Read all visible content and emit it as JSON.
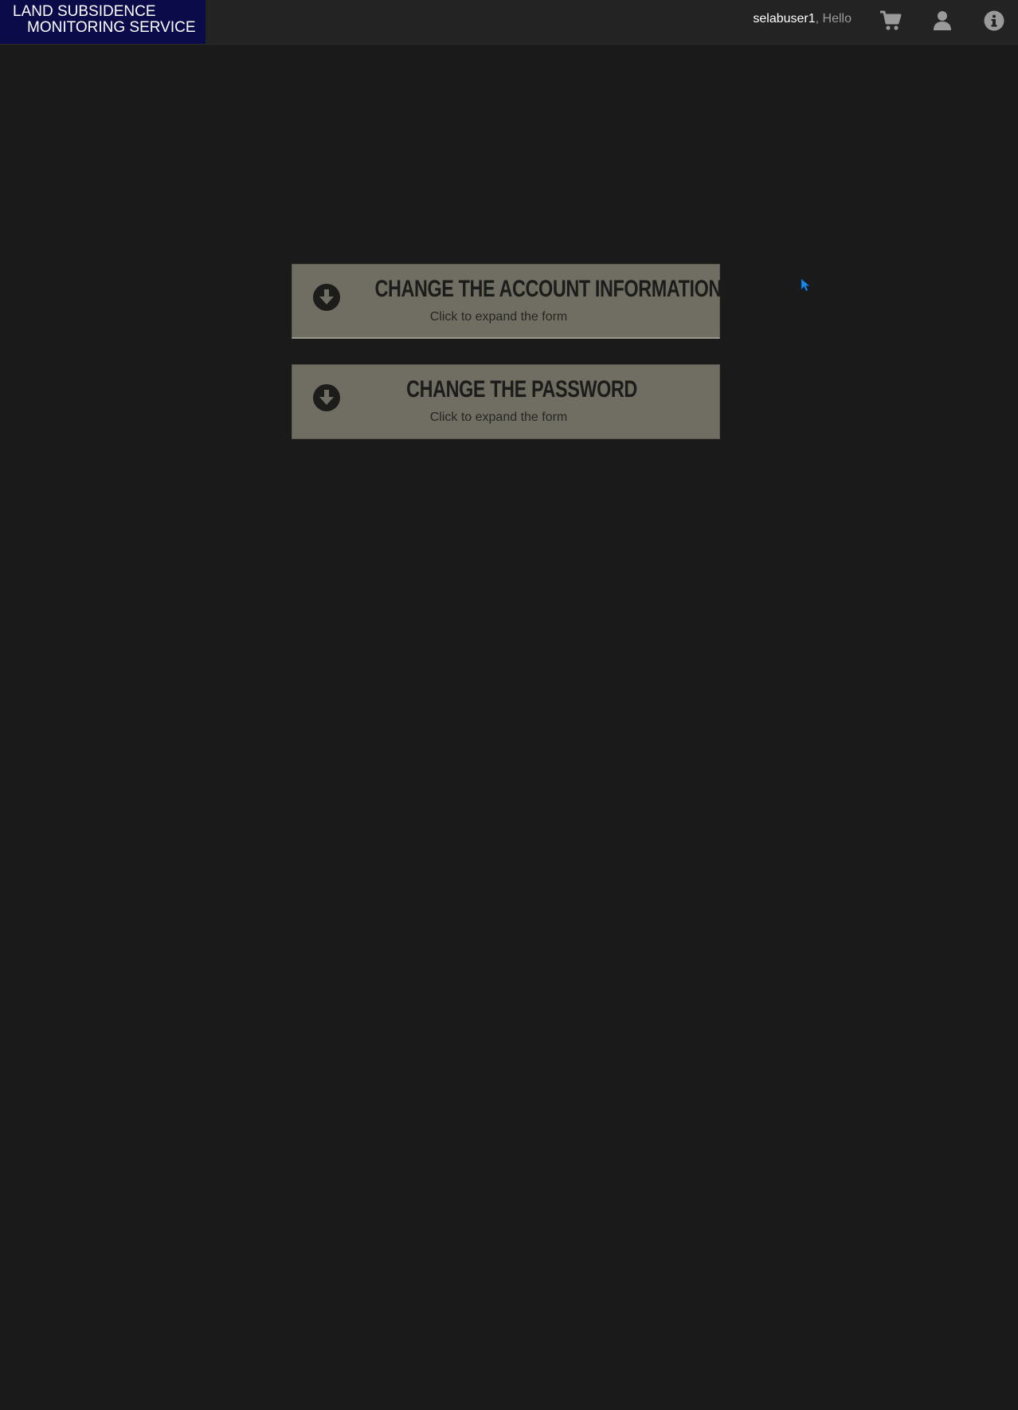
{
  "header": {
    "logo_line1": "LAND SUBSIDENCE",
    "logo_line2": "MONITORING SERVICE",
    "username": "selabuser1",
    "greeting_suffix": ", Hello",
    "icons": [
      "cart-icon",
      "user-icon",
      "info-icon"
    ],
    "colors": {
      "bar_bg": "#222322",
      "logo_bg": "#0b0b4a",
      "icon": "#9a9a9a"
    }
  },
  "panels": [
    {
      "title": "CHANGE THE ACCOUNT INFORMATION",
      "subtitle": "Click to expand the form",
      "icon": "arrow-circle-down-icon"
    },
    {
      "title": "CHANGE THE PASSWORD",
      "subtitle": "Click to expand the form",
      "icon": "arrow-circle-down-icon"
    }
  ],
  "colors": {
    "page_bg": "#191a19",
    "panel_bg": "#706d62",
    "panel_text": "#1c1c1b",
    "cursor": "#1e88e5"
  }
}
